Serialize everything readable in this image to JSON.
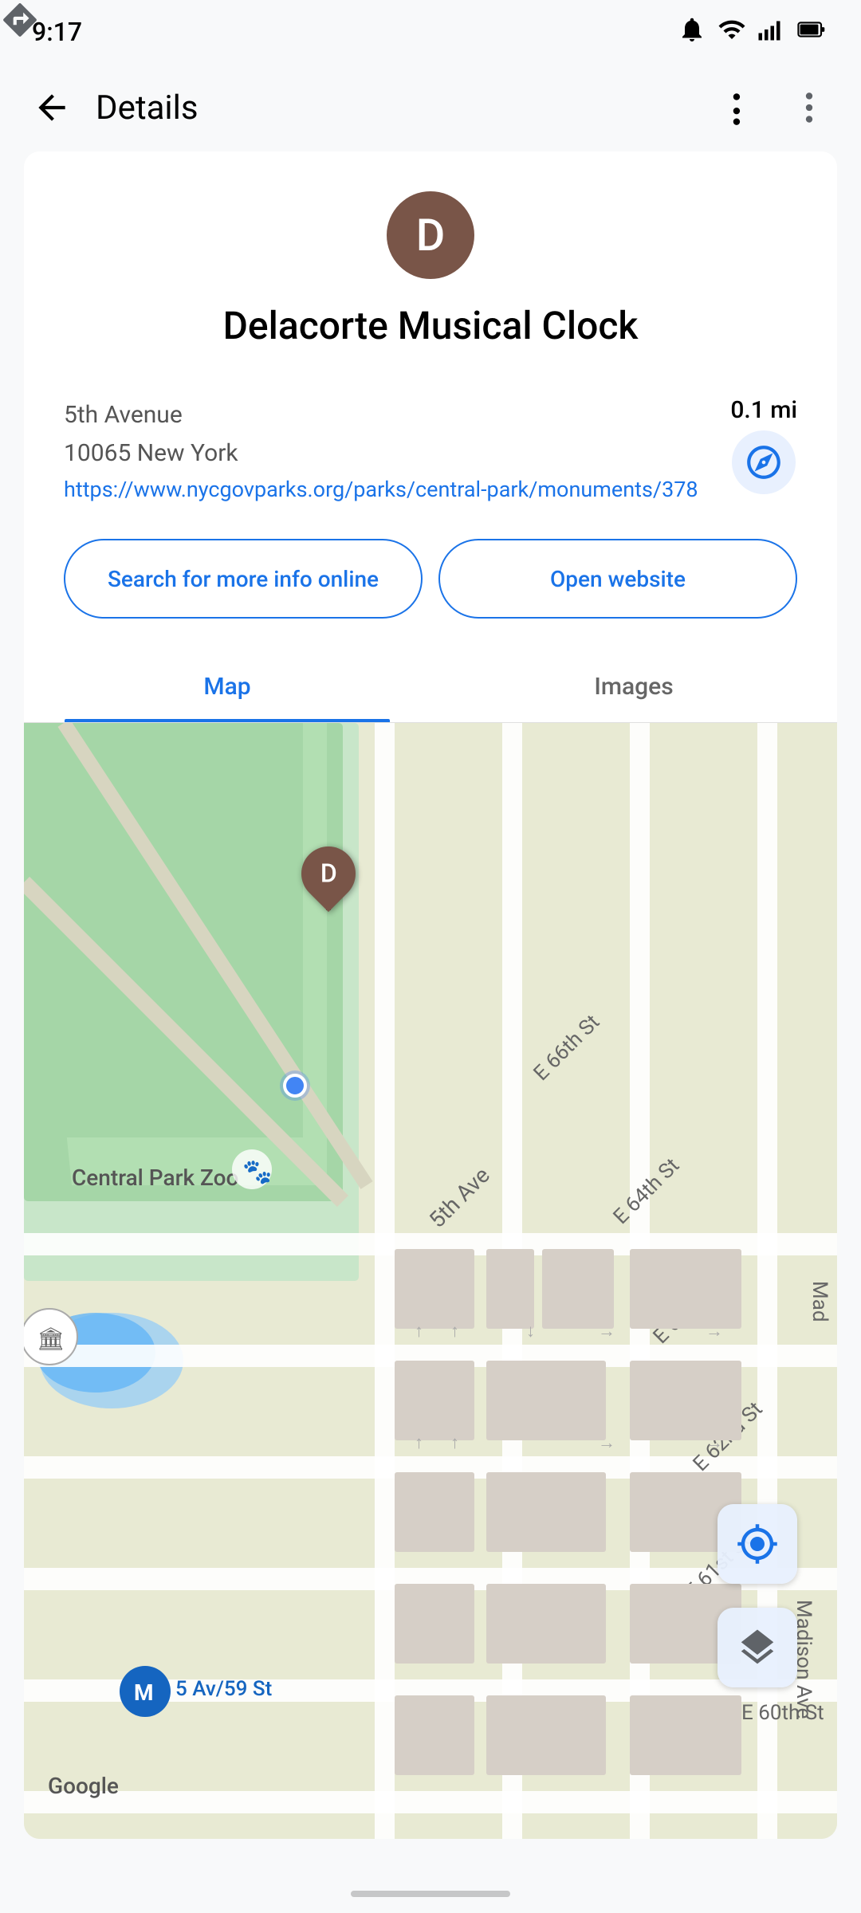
{
  "statusBar": {
    "time": "9:17",
    "icons": [
      "notification-icon",
      "wifi-icon",
      "signal-icon",
      "battery-icon"
    ]
  },
  "appBar": {
    "title": "Details",
    "backLabel": "←",
    "shareLabel": "⇒",
    "moreLabel": "⋮"
  },
  "place": {
    "avatarLetter": "D",
    "name": "Delacorte Musical Clock",
    "addressLine1": "5th Avenue",
    "addressLine2": "10065 New York",
    "url": "https://www.nycgovparks.org/parks/central-park/monuments/378",
    "distance": "0.1 mi"
  },
  "actions": {
    "searchOnline": "Search for more info online",
    "openWebsite": "Open website"
  },
  "tabs": [
    {
      "id": "map",
      "label": "Map",
      "active": true
    },
    {
      "id": "images",
      "label": "Images",
      "active": false
    }
  ],
  "map": {
    "pinLetter": "D",
    "googleLogo": "Google"
  },
  "colors": {
    "primary": "#1a73e8",
    "avatar": "#795548",
    "parkGreen": "#c8e6c9",
    "roadColor": "#ffffff",
    "mapBg": "#e8ead3"
  }
}
